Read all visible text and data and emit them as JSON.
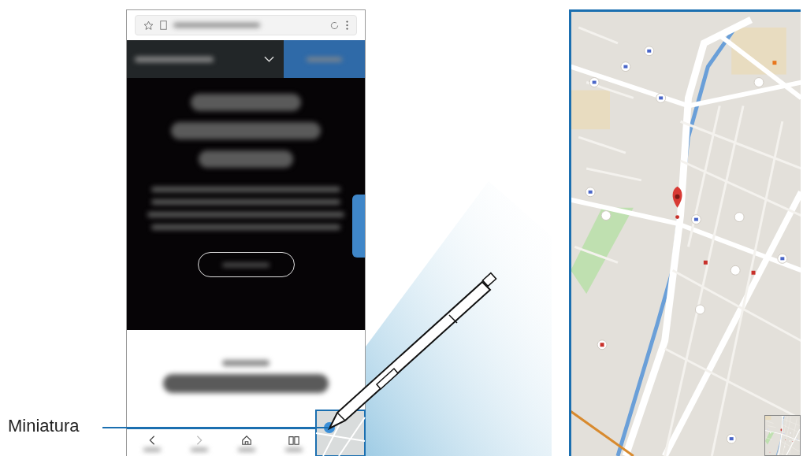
{
  "callout": {
    "label": "Miniatura"
  }
}
